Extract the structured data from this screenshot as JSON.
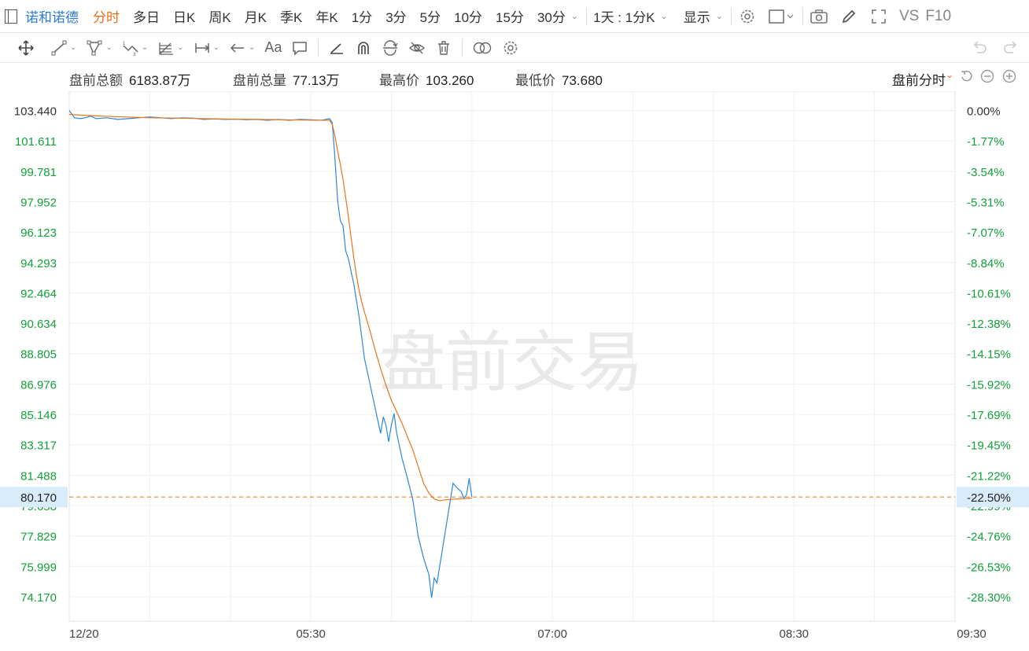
{
  "top_bar": {
    "stock_name": "诺和诺德",
    "timeframes": [
      "分时",
      "多日",
      "日K",
      "周K",
      "月K",
      "季K",
      "年K",
      "1分",
      "3分",
      "5分",
      "10分",
      "15分",
      "30分"
    ],
    "active_timeframe": "分时",
    "period_select": "1天 : 1分K",
    "display_label": "显示",
    "vs_label": "VS",
    "f10_label": "F10"
  },
  "info": {
    "amount_label": "盘前总额",
    "amount_value": "6183.87万",
    "volume_label": "盘前总量",
    "volume_value": "77.13万",
    "high_label": "最高价",
    "high_value": "103.260",
    "low_label": "最低价",
    "low_value": "73.680",
    "mode_label": "盘前分时"
  },
  "colors": {
    "accent": "#ef6b10",
    "price_line": "#2f86dc",
    "avg_line": "#e8741c",
    "down_green": "#12a13a",
    "grid": "#eef0f3"
  },
  "chart_data": {
    "type": "line",
    "watermark": "盘前交易",
    "prev_close": 103.44,
    "current_price": 80.17,
    "current_pct": "-22.50%",
    "ylim": [
      72.7,
      104.6
    ],
    "y_ticks": [
      "103.440",
      "101.611",
      "99.781",
      "97.952",
      "96.123",
      "94.293",
      "92.464",
      "90.634",
      "88.805",
      "86.976",
      "85.146",
      "83.317",
      "81.488",
      "79.658",
      "77.829",
      "75.999",
      "74.170"
    ],
    "pct_ticks": [
      "0.00%",
      "-1.77%",
      "-3.54%",
      "-5.31%",
      "-7.07%",
      "-8.84%",
      "-10.61%",
      "-12.38%",
      "-14.15%",
      "-15.92%",
      "-17.69%",
      "-19.45%",
      "-21.22%",
      "-22.99%",
      "-24.76%",
      "-26.53%",
      "-28.30%"
    ],
    "x_ticks": [
      {
        "label": "12/20",
        "t": 0
      },
      {
        "label": "05:30",
        "t": 90
      },
      {
        "label": "07:00",
        "t": 180
      },
      {
        "label": "08:30",
        "t": 270
      },
      {
        "label": "09:30",
        "t": 330
      }
    ],
    "x_range": [
      0,
      330
    ],
    "series": [
      {
        "key": "price",
        "points": [
          [
            0,
            103.44
          ],
          [
            2,
            103.0
          ],
          [
            4,
            102.95
          ],
          [
            6,
            103.0
          ],
          [
            8,
            103.1
          ],
          [
            10,
            102.95
          ],
          [
            14,
            103.0
          ],
          [
            18,
            102.9
          ],
          [
            22,
            102.95
          ],
          [
            26,
            103.0
          ],
          [
            30,
            103.05
          ],
          [
            34,
            103.0
          ],
          [
            38,
            102.95
          ],
          [
            42,
            103.0
          ],
          [
            46,
            102.98
          ],
          [
            50,
            102.9
          ],
          [
            54,
            102.93
          ],
          [
            58,
            102.9
          ],
          [
            62,
            102.92
          ],
          [
            66,
            102.88
          ],
          [
            70,
            102.9
          ],
          [
            74,
            102.85
          ],
          [
            78,
            102.9
          ],
          [
            82,
            102.85
          ],
          [
            86,
            102.9
          ],
          [
            90,
            102.88
          ],
          [
            94,
            102.85
          ],
          [
            97,
            102.95
          ],
          [
            98,
            102.7
          ],
          [
            99,
            100.5
          ],
          [
            100,
            98.0
          ],
          [
            101,
            96.8
          ],
          [
            102,
            96.5
          ],
          [
            103,
            95.0
          ],
          [
            104,
            94.5
          ],
          [
            106,
            93.0
          ],
          [
            108,
            91.0
          ],
          [
            110,
            88.5
          ],
          [
            112,
            87.0
          ],
          [
            114,
            85.5
          ],
          [
            116,
            84.0
          ],
          [
            117,
            85.0
          ],
          [
            118,
            84.5
          ],
          [
            119,
            83.5
          ],
          [
            120,
            84.5
          ],
          [
            121,
            85.2
          ],
          [
            122,
            84.0
          ],
          [
            124,
            82.5
          ],
          [
            126,
            81.3
          ],
          [
            128,
            80.0
          ],
          [
            130,
            77.8
          ],
          [
            132,
            76.5
          ],
          [
            134,
            75.5
          ],
          [
            135,
            74.1
          ],
          [
            136,
            75.3
          ],
          [
            137,
            75.0
          ],
          [
            138,
            76.0
          ],
          [
            140,
            78.0
          ],
          [
            142,
            80.0
          ],
          [
            143,
            81.0
          ],
          [
            144,
            80.8
          ],
          [
            146,
            80.5
          ],
          [
            147,
            80.1
          ],
          [
            148,
            80.3
          ],
          [
            149,
            81.3
          ],
          [
            150,
            80.17
          ]
        ]
      },
      {
        "key": "avg",
        "points": [
          [
            0,
            103.2
          ],
          [
            6,
            103.15
          ],
          [
            12,
            103.1
          ],
          [
            20,
            103.05
          ],
          [
            30,
            103.0
          ],
          [
            40,
            102.98
          ],
          [
            50,
            102.95
          ],
          [
            60,
            102.92
          ],
          [
            70,
            102.9
          ],
          [
            80,
            102.88
          ],
          [
            90,
            102.86
          ],
          [
            97,
            102.85
          ],
          [
            98,
            102.6
          ],
          [
            99,
            101.9
          ],
          [
            100,
            101.0
          ],
          [
            101,
            100.2
          ],
          [
            102,
            99.3
          ],
          [
            103,
            98.2
          ],
          [
            104,
            97.0
          ],
          [
            105,
            95.8
          ],
          [
            106,
            94.6
          ],
          [
            107,
            93.5
          ],
          [
            108,
            92.6
          ],
          [
            109,
            91.9
          ],
          [
            110,
            91.3
          ],
          [
            112,
            90.2
          ],
          [
            114,
            89.0
          ],
          [
            116,
            87.9
          ],
          [
            118,
            86.9
          ],
          [
            120,
            86.0
          ],
          [
            122,
            85.3
          ],
          [
            124,
            84.6
          ],
          [
            126,
            83.8
          ],
          [
            128,
            83.0
          ],
          [
            130,
            82.0
          ],
          [
            132,
            81.0
          ],
          [
            134,
            80.4
          ],
          [
            136,
            80.05
          ],
          [
            138,
            79.95
          ],
          [
            140,
            80.0
          ],
          [
            144,
            80.05
          ],
          [
            150,
            80.1
          ]
        ]
      }
    ]
  }
}
